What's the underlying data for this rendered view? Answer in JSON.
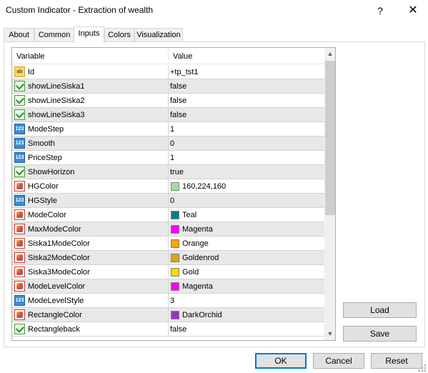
{
  "window": {
    "title": "Custom Indicator - Extraction of wealth",
    "help_label": "?",
    "close_label": "✕"
  },
  "tabs": [
    {
      "label": "About",
      "active": false
    },
    {
      "label": "Common",
      "active": false
    },
    {
      "label": "Inputs",
      "active": true
    },
    {
      "label": "Colors",
      "active": false
    },
    {
      "label": "Visualization",
      "active": false
    }
  ],
  "grid": {
    "col_variable": "Variable",
    "col_value": "Value",
    "rows": [
      {
        "icon": "text-icon",
        "name": "Id",
        "value": "+tp_tst1"
      },
      {
        "icon": "bool-icon",
        "name": "showLineSiska1",
        "value": "false"
      },
      {
        "icon": "bool-icon",
        "name": "showLineSiska2",
        "value": "false"
      },
      {
        "icon": "bool-icon",
        "name": "showLineSiska3",
        "value": "false"
      },
      {
        "icon": "number-icon",
        "name": "ModeStep",
        "value": "1"
      },
      {
        "icon": "number-icon",
        "name": "Smooth",
        "value": "0"
      },
      {
        "icon": "number-icon",
        "name": "PriceStep",
        "value": "1"
      },
      {
        "icon": "bool-icon",
        "name": "ShowHorizon",
        "value": "true"
      },
      {
        "icon": "color-icon",
        "name": "HGColor",
        "value": "160,224,160",
        "swatch": "#a0e0a0"
      },
      {
        "icon": "number-icon",
        "name": "HGStyle",
        "value": "0"
      },
      {
        "icon": "color-icon",
        "name": "ModeColor",
        "value": "Teal",
        "swatch": "#008080"
      },
      {
        "icon": "color-icon",
        "name": "MaxModeColor",
        "value": "Magenta",
        "swatch": "#ff00ff"
      },
      {
        "icon": "color-icon",
        "name": "Siska1ModeColor",
        "value": "Orange",
        "swatch": "#ffa500"
      },
      {
        "icon": "color-icon",
        "name": "Siska2ModeColor",
        "value": "Goldenrod",
        "swatch": "#daa520"
      },
      {
        "icon": "color-icon",
        "name": "Siska3ModeColor",
        "value": "Gold",
        "swatch": "#ffd700"
      },
      {
        "icon": "color-icon",
        "name": "ModeLevelColor",
        "value": "Magenta",
        "swatch": "#ff00ff"
      },
      {
        "icon": "number-icon",
        "name": "ModeLevelStyle",
        "value": "3"
      },
      {
        "icon": "color-icon",
        "name": "RectangleColor",
        "value": "DarkOrchid",
        "swatch": "#9932cc"
      },
      {
        "icon": "bool-icon",
        "name": "Rectangleback",
        "value": "false"
      }
    ]
  },
  "scrollbar": {
    "up_arrow": "▲",
    "down_arrow": "▼"
  },
  "buttons": {
    "load": "Load",
    "save": "Save",
    "ok": "OK",
    "cancel": "Cancel",
    "reset": "Reset"
  }
}
